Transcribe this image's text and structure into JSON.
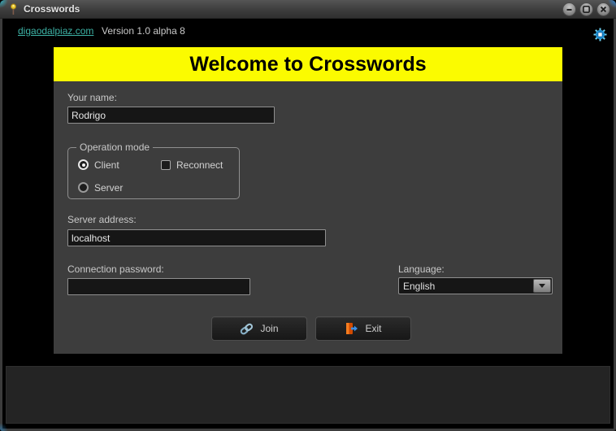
{
  "window": {
    "title": "Crosswords",
    "controls": {
      "minimize": "minimize-button",
      "maximize": "maximize-button",
      "close": "close-button"
    }
  },
  "header": {
    "link": "digaodalpiaz.com",
    "version": "Version 1.0 alpha 8",
    "settings_icon": "gear-icon"
  },
  "banner": {
    "title": "Welcome to Crosswords",
    "background": "#fbfb00",
    "text_color": "#000000"
  },
  "form": {
    "name": {
      "label": "Your name:",
      "value": "Rodrigo"
    },
    "operation_mode": {
      "legend": "Operation mode",
      "options": [
        {
          "label": "Client",
          "type": "radio",
          "selected": true
        },
        {
          "label": "Server",
          "type": "radio",
          "selected": false
        }
      ],
      "reconnect": {
        "label": "Reconnect",
        "type": "checkbox",
        "checked": false
      }
    },
    "server_address": {
      "label": "Server address:",
      "value": "localhost"
    },
    "connection_password": {
      "label": "Connection password:",
      "value": ""
    },
    "language": {
      "label": "Language:",
      "selected_option": "English"
    },
    "buttons": {
      "join": {
        "label": "Join",
        "icon": "chain-link-icon",
        "icon_color": "#93bcd4"
      },
      "exit": {
        "label": "Exit",
        "icon": "door-exit-icon",
        "icon_color": "#f25c05",
        "arrow_color": "#3a8fe8"
      }
    }
  },
  "colors": {
    "link": "#3db3a6",
    "panel": "#3d3d3d",
    "client_bg": "#000000",
    "gear": "#35aee0"
  }
}
